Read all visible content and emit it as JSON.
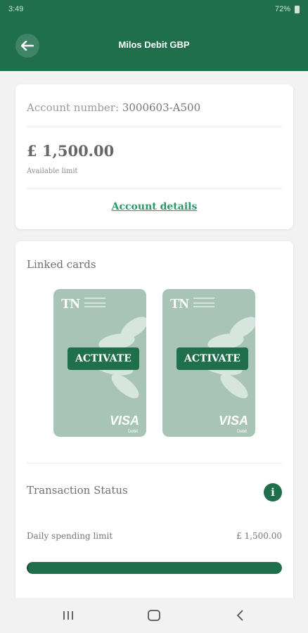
{
  "status_bar": {
    "time": "3:49",
    "indicators": "72%"
  },
  "header": {
    "title": "Milos Debit GBP",
    "back_icon": "arrow-left-icon"
  },
  "account": {
    "number_label": "Account number:",
    "number_value": "3000603-A500",
    "balance": "£ 1,500.00",
    "balance_label": "Available limit",
    "details_link": "Account details"
  },
  "linked_cards": {
    "title": "Linked cards",
    "cards": [
      {
        "brand": "TN",
        "activate_label": "ACTIVATE",
        "network": "VISA",
        "type": "Debit"
      },
      {
        "brand": "TN",
        "activate_label": "ACTIVATE",
        "network": "VISA",
        "type": "Debit"
      }
    ]
  },
  "transaction_status": {
    "title": "Transaction Status",
    "info_icon": "info-icon",
    "daily_limit_label": "Daily spending limit",
    "daily_limit_value": "£ 1,500.00",
    "progress": 1.0
  },
  "colors": {
    "primary": "#1f6f4d",
    "link": "#2a9968",
    "card": "#a7c4b7"
  },
  "nav_bar": {
    "recents_icon": "recents-icon",
    "home_icon": "home-icon",
    "back_icon": "chevron-left-icon"
  }
}
